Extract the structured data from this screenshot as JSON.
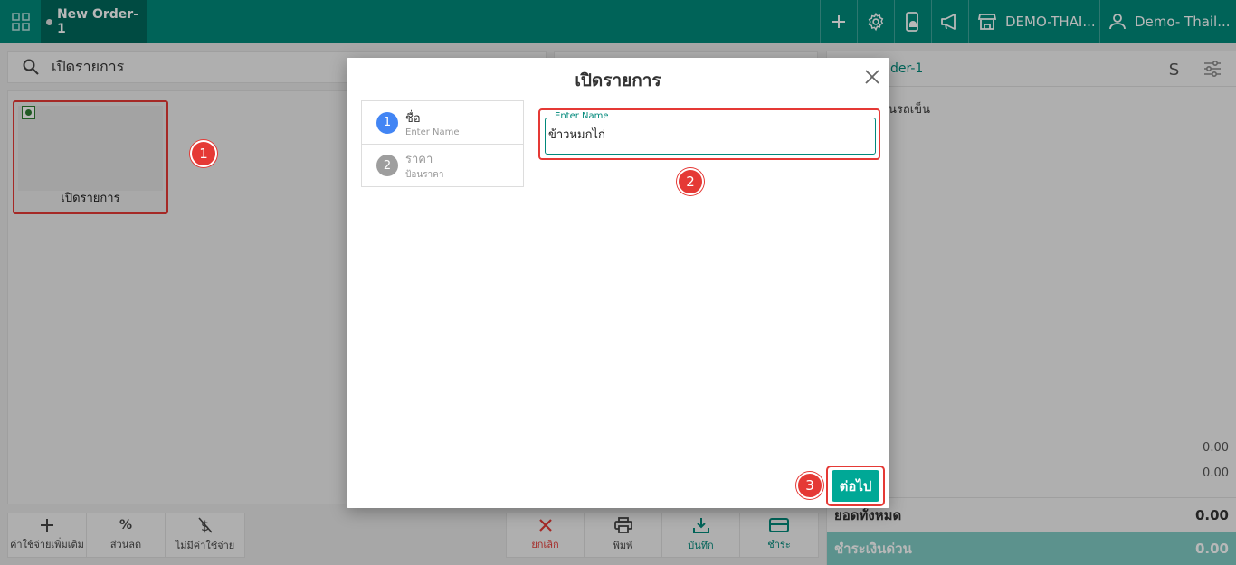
{
  "topbar": {
    "order_tab": "New Order-1",
    "store_name": "DEMO-THAI...",
    "user_name": "Demo- Thail...",
    "accent_color": "#00897b"
  },
  "search": {
    "text": "เปิดรายการ"
  },
  "product": {
    "name": "เปิดรายการ"
  },
  "actions_left": [
    {
      "label": "ค่าใช้จ่ายเพิ่มเติม",
      "icon": "plus-icon"
    },
    {
      "label": "ส่วนลด",
      "icon": "percent-icon"
    },
    {
      "label": "ไม่มีค่าใช้จ่าย",
      "icon": "no-dollar-icon"
    }
  ],
  "actions_right": [
    {
      "label": "ยกเลิก",
      "icon": "close-icon"
    },
    {
      "label": "พิมพ์",
      "icon": "printer-icon"
    },
    {
      "label": "บันทึก",
      "icon": "download-icon"
    },
    {
      "label": "ชำระ",
      "icon": "card-icon"
    }
  ],
  "right_panel": {
    "order_label": "der-1",
    "line_item": "นรถเข็น",
    "value_1": "0.00",
    "value_2": "0.00",
    "total_label": "ยอดทั้งหมด",
    "total_value": "0.00",
    "quick_pay_label": "ชำระเงินด่วน",
    "quick_pay_value": "0.00"
  },
  "modal": {
    "title": "เปิดรายการ",
    "steps": [
      {
        "num": "1",
        "title": "ชื่อ",
        "subtitle": "Enter Name"
      },
      {
        "num": "2",
        "title": "ราคา",
        "subtitle": "ป้อนราคา"
      }
    ],
    "field_label": "Enter Name",
    "field_value": "ข้าวหมกไก่",
    "next_label": "ต่อไป"
  },
  "markers": [
    "1",
    "2",
    "3"
  ]
}
